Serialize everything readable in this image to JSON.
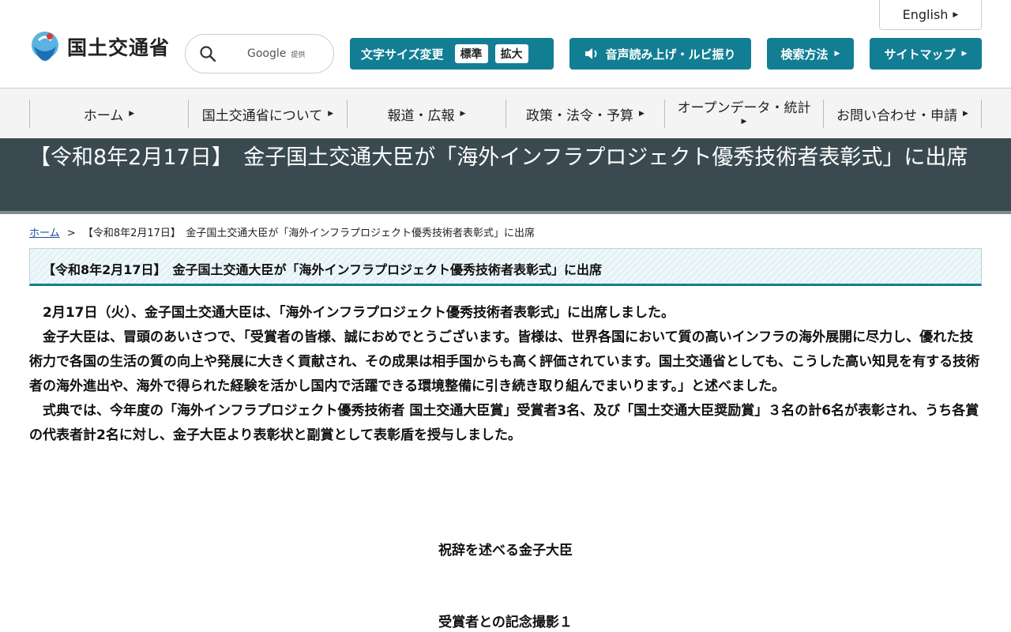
{
  "header": {
    "logo_text": "国土交通省",
    "search": {
      "provider": "Google",
      "provider_sub": "提供"
    },
    "english_label": "English",
    "text_size": {
      "label": "文字サイズ変更",
      "standard": "標準",
      "large": "拡大"
    },
    "voice_label": "音声読み上げ・ルビ振り",
    "search_method_label": "検索方法",
    "sitemap_label": "サイトマップ"
  },
  "nav": {
    "items": [
      {
        "label": "ホーム"
      },
      {
        "label": "国土交通省について"
      },
      {
        "label": "報道・広報"
      },
      {
        "label": "政策・法令・予算"
      },
      {
        "label": "オープンデータ・統計"
      },
      {
        "label": "お問い合わせ・申請"
      }
    ]
  },
  "page": {
    "title": "【令和8年2月17日】　金子国土交通大臣が「海外インフラプロジェクト優秀技術者表彰式」に出席",
    "breadcrumb_home": "ホーム",
    "breadcrumb_sep": ">",
    "breadcrumb_current": "【令和8年2月17日】　金子国土交通大臣が「海外インフラプロジェクト優秀技術者表彰式」に出席",
    "section_heading": "【令和8年2月17日】　金子国土交通大臣が「海外インフラプロジェクト優秀技術者表彰式」に出席",
    "paragraphs": [
      "2月17日（火）、金子国土交通大臣は、「海外インフラプロジェクト優秀技術者表彰式」に出席しました。",
      "金子大臣は、冒頭のあいさつで、「受賞者の皆様、誠におめでとうございます。皆様は、世界各国において質の高いインフラの海外展開に尽力し、優れた技術力で各国の生活の質の向上や発展に大きく貢献され、その成果は相手国からも高く評価されています。国土交通省としても、こうした高い知見を有する技術者の海外進出や、海外で得られた経験を活かし国内で活躍できる環境整備に引き続き取り組んでまいります。」と述べました。",
      "式典では、今年度の「海外インフラプロジェクト優秀技術者 国土交通大臣賞」受賞者3名、及び「国土交通大臣奨励賞」３名の計6名が表彰され、うち各賞の代表者計2名に対し、金子大臣より表彰状と副賞として表彰盾を授与しました。"
    ],
    "caption1": "祝辞を述べる金子大臣",
    "caption2": "受賞者との記念撮影１"
  },
  "colors": {
    "accent": "#127e93",
    "title_band": "#3a4a50",
    "link": "#1a4ea0"
  }
}
